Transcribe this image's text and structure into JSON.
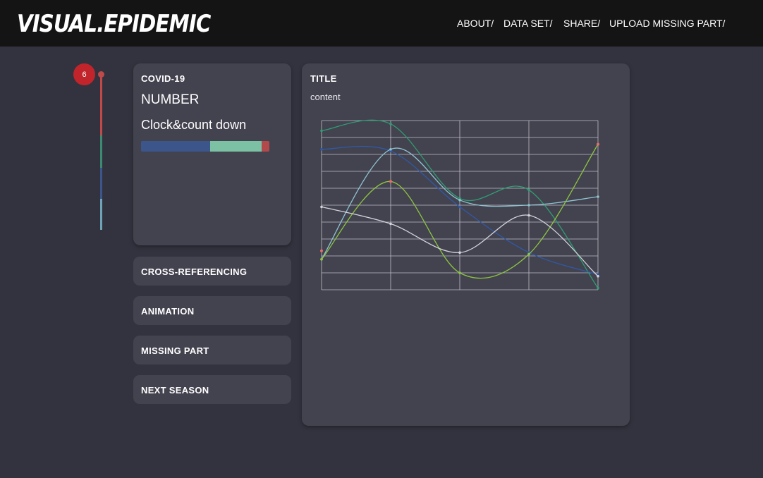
{
  "app": {
    "logo": "VISUAL.EPIDEMIC"
  },
  "nav": [
    {
      "label": "ABOUT/"
    },
    {
      "label": "DATA SET/"
    },
    {
      "label": "SHARE/"
    },
    {
      "label": "UPLOAD MISSING PART/"
    }
  ],
  "timeline": {
    "badge": "6",
    "colors": [
      "#c0494a",
      "#3d8a73",
      "#3c558b",
      "#6fa3b8"
    ]
  },
  "covid_card": {
    "title": "COVID-19",
    "number": "NUMBER",
    "clock": "Clock&count down",
    "progress": [
      {
        "fraction": 0.54,
        "color": "#3c558b"
      },
      {
        "fraction": 0.4,
        "color": "#7dc1a4"
      },
      {
        "fraction": 0.06,
        "color": "#b24a4b"
      }
    ]
  },
  "menu": [
    {
      "label": "CROSS-REFERENCING"
    },
    {
      "label": "ANIMATION"
    },
    {
      "label": "MISSING PART"
    },
    {
      "label": "NEXT SEASON"
    }
  ],
  "main_card": {
    "title": "TITLE",
    "content": "content"
  },
  "chart_data": {
    "type": "line",
    "title": "",
    "xlabel": "",
    "ylabel": "",
    "x": [
      0,
      1,
      2,
      3,
      4
    ],
    "ylim": [
      0,
      10
    ],
    "grid": true,
    "smooth": true,
    "series": [
      {
        "values": [
          9.4,
          9.8,
          5.4,
          5.9,
          0.1
        ],
        "color": "#2f9e73"
      },
      {
        "values": [
          8.3,
          8.2,
          4.9,
          2.2,
          0.9
        ],
        "color": "#2f5aa8"
      },
      {
        "values": [
          1.8,
          8.3,
          5.3,
          5.0,
          5.5
        ],
        "color": "#8fc3d1"
      },
      {
        "values": [
          1.8,
          6.4,
          1.0,
          2.1,
          8.6
        ],
        "color": "#8cc63f"
      },
      {
        "values": [
          4.9,
          3.9,
          2.2,
          4.4,
          0.8
        ],
        "color": "#d4d4dc"
      }
    ],
    "end_markers": [
      {
        "x": 0,
        "y": 2.3,
        "color": "#e96a6a"
      },
      {
        "x": 1,
        "y": 6.4,
        "color": "#e96a6a"
      },
      {
        "x": 4,
        "y": 8.6,
        "color": "#e96a6a"
      }
    ]
  }
}
